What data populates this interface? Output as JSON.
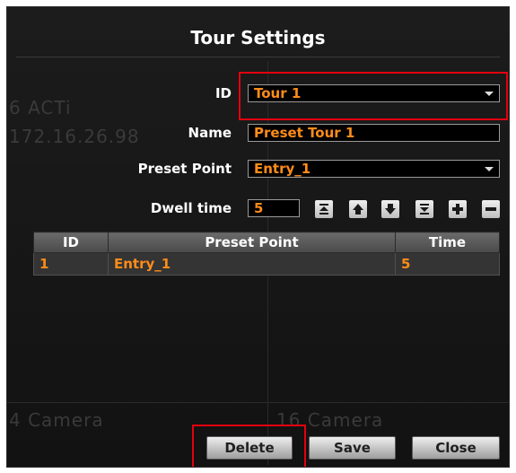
{
  "dialog": {
    "title": "Tour Settings"
  },
  "background": {
    "text_1": "6 ACTi",
    "text_2": "172.16.26.98",
    "text_3": "4 Camera",
    "text_4": "16 Camera"
  },
  "form": {
    "id_label": "ID",
    "id_value": "Tour 1",
    "name_label": "Name",
    "name_value": "Preset Tour 1",
    "preset_label": "Preset Point",
    "preset_value": "Entry_1",
    "dwell_label": "Dwell time",
    "dwell_value": "5"
  },
  "toolbar": {
    "icons": [
      "move-to-top-icon",
      "move-up-icon",
      "move-down-icon",
      "move-to-bottom-icon",
      "add-icon",
      "remove-icon"
    ]
  },
  "table": {
    "headers": [
      "ID",
      "Preset Point",
      "Time"
    ],
    "rows": [
      [
        "1",
        "Entry_1",
        "5"
      ]
    ]
  },
  "footer": {
    "delete_label": "Delete",
    "save_label": "Save",
    "close_label": "Close"
  },
  "colors": {
    "accent": "#ff8c1a",
    "highlight": "#e3000f"
  }
}
